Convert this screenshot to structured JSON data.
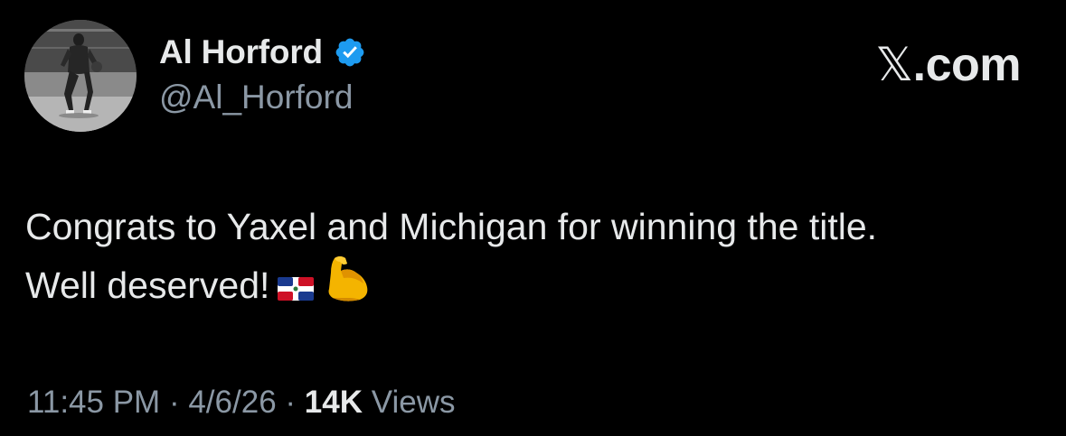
{
  "author": {
    "display_name": "Al Horford",
    "handle": "@Al_Horford",
    "verified_icon": "verified-badge-icon",
    "verified_color": "#1d9bf0"
  },
  "brand": {
    "x_glyph": "𝕏",
    "suffix": ".com"
  },
  "tweet": {
    "line1": "Congrats to Yaxel and Michigan for winning the title.",
    "line2": "Well deserved!",
    "emojis": [
      "dominican-republic-flag-icon",
      "flexed-biceps-icon"
    ]
  },
  "meta": {
    "time": "11:45 PM",
    "sep1": "·",
    "date": "4/6/26",
    "sep2": "·",
    "views_count": "14K",
    "views_label": "Views"
  },
  "colors": {
    "background": "#000000",
    "primary_text": "#e7e9ea",
    "secondary_text": "#8b98a5"
  }
}
